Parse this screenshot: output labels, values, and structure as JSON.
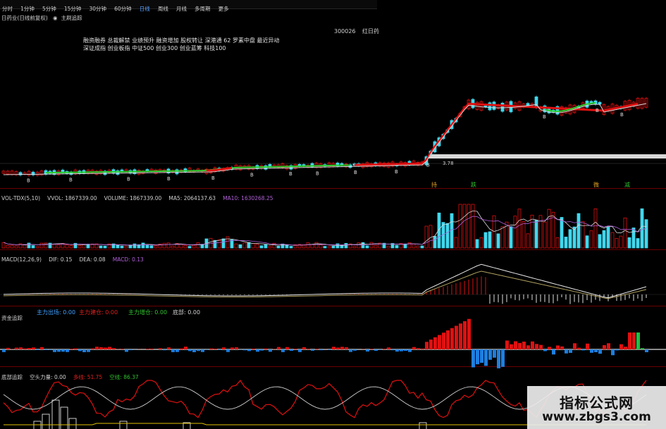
{
  "toolbar": {
    "tabs": [
      {
        "label": "分时"
      },
      {
        "label": "1分钟"
      },
      {
        "label": "5分钟"
      },
      {
        "label": "15分钟"
      },
      {
        "label": "30分钟"
      },
      {
        "label": "60分钟"
      },
      {
        "label": "日线",
        "selected": true
      },
      {
        "label": "周线"
      },
      {
        "label": "月线"
      },
      {
        "label": "多周期"
      },
      {
        "label": "更多"
      }
    ]
  },
  "security": {
    "name": "日药业(日线前复权)",
    "indicator": "主刷追踪"
  },
  "code": "300026",
  "code_suffix": "红日药",
  "concepts": {
    "line1": "融资融券 总裁解禁 业绩预升 融资增加 股权转让 深港通 62 罗素中盘 最近异动",
    "line2": "深证成指 创业板指 中证500 创业300 创业蓝筹 科技100"
  },
  "price_panel": {
    "low_label": "3.78",
    "markers": [
      {
        "label": "B"
      },
      {
        "label": "B"
      },
      {
        "label": "B"
      },
      {
        "label": "B"
      },
      {
        "label": "B"
      },
      {
        "label": "B"
      },
      {
        "label": "B"
      },
      {
        "label": "B"
      },
      {
        "label": "B"
      },
      {
        "label": "B"
      },
      {
        "label": "B"
      },
      {
        "label": "B"
      },
      {
        "label": "B"
      },
      {
        "label": "B"
      }
    ],
    "bottom_tags": [
      "持",
      "跌",
      "微",
      "减"
    ]
  },
  "volume_panel": {
    "title": "VOL-TDX(5,10)",
    "vvol": "VVOL: 1867339.00",
    "volume": "VOLUME: 1867339.00",
    "ma5": "MA5: 2064137.63",
    "ma10": "MA10: 1630268.25"
  },
  "macd_panel": {
    "title": "MACD(12,26,9)",
    "dif": "DIF: 0.15",
    "dea": "DEA: 0.08",
    "macd": "MACD: 0.13"
  },
  "fund_panel": {
    "title": "资金追踪",
    "out": "主力出场: 0.00",
    "in": "主力建仓: 0.00",
    "add": "主力增仓: 0.00",
    "bottom": "底部: 0.00"
  },
  "bottom_panel": {
    "title": "底部追踪",
    "power": "空头力量: 0.00",
    "long": "多线: 51.75",
    "short": "空线: 86.37"
  },
  "watermark": {
    "line1": "指标公式网",
    "line2": "www.zbgs3.com"
  },
  "colors": {
    "up": "#e01010",
    "down": "#40d8ee",
    "ma_white": "#d8d8d8",
    "ma_green": "#30d030",
    "ma_purple": "#b060d8",
    "blue_bar": "#1e7fe0",
    "green_bar": "#20c040"
  }
}
